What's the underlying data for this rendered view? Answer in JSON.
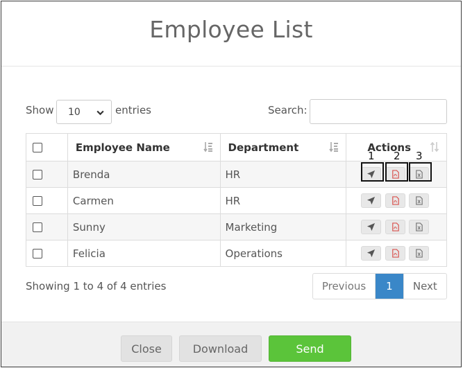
{
  "modal": {
    "title": "Employee List"
  },
  "controls": {
    "show_label": "Show",
    "page_size": "10",
    "entries_label": "entries",
    "search_label": "Search:",
    "search_value": ""
  },
  "table": {
    "headers": {
      "name": "Employee Name",
      "department": "Department",
      "actions": "Actions"
    },
    "rows": [
      {
        "name": "Brenda",
        "department": "HR"
      },
      {
        "name": "Carmen",
        "department": "HR"
      },
      {
        "name": "Sunny",
        "department": "Marketing"
      },
      {
        "name": "Felicia",
        "department": "Operations"
      }
    ]
  },
  "callouts": {
    "one": "1",
    "two": "2",
    "three": "3"
  },
  "pagination": {
    "info": "Showing 1 to 4 of 4 entries",
    "previous": "Previous",
    "current": "1",
    "next": "Next"
  },
  "footer": {
    "close": "Close",
    "download": "Download",
    "send": "Send"
  },
  "colors": {
    "send": "#5bc43a",
    "active_page": "#3a87c8",
    "pdf_icon": "#d9534f"
  },
  "icons": {
    "send_action": "paper-plane-icon",
    "pdf_action": "pdf-file-icon",
    "excel_action": "excel-file-icon"
  }
}
